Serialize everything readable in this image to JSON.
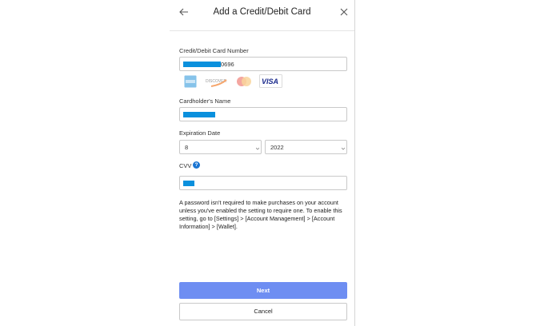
{
  "header": {
    "title": "Add a Credit/Debit Card"
  },
  "card_number": {
    "label": "Credit/Debit Card Number",
    "value_suffix": "0696"
  },
  "accepted_cards": [
    {
      "name": "American Express",
      "icon": "amex-icon"
    },
    {
      "name": "DISCOVER",
      "icon": "discover-icon"
    },
    {
      "name": "Mastercard",
      "icon": "mastercard-icon"
    },
    {
      "name": "VISA",
      "icon": "visa-icon"
    }
  ],
  "cardholder": {
    "label": "Cardholder's Name"
  },
  "expiration": {
    "label": "Expiration Date",
    "month": "8",
    "year": "2022"
  },
  "cvv": {
    "label": "CVV",
    "help": "?"
  },
  "info": {
    "text": "A password isn't required to make purchases on your account unless you've enabled the setting to require one. To enable this setting, go to [Settings] > [Account Management] > [Account Information] > [Wallet]."
  },
  "actions": {
    "next": "Next",
    "cancel": "Cancel"
  },
  "colors": {
    "primary_button": "#6e8ef2",
    "redaction": "#0a90dd",
    "help_icon": "#1a75d2"
  }
}
